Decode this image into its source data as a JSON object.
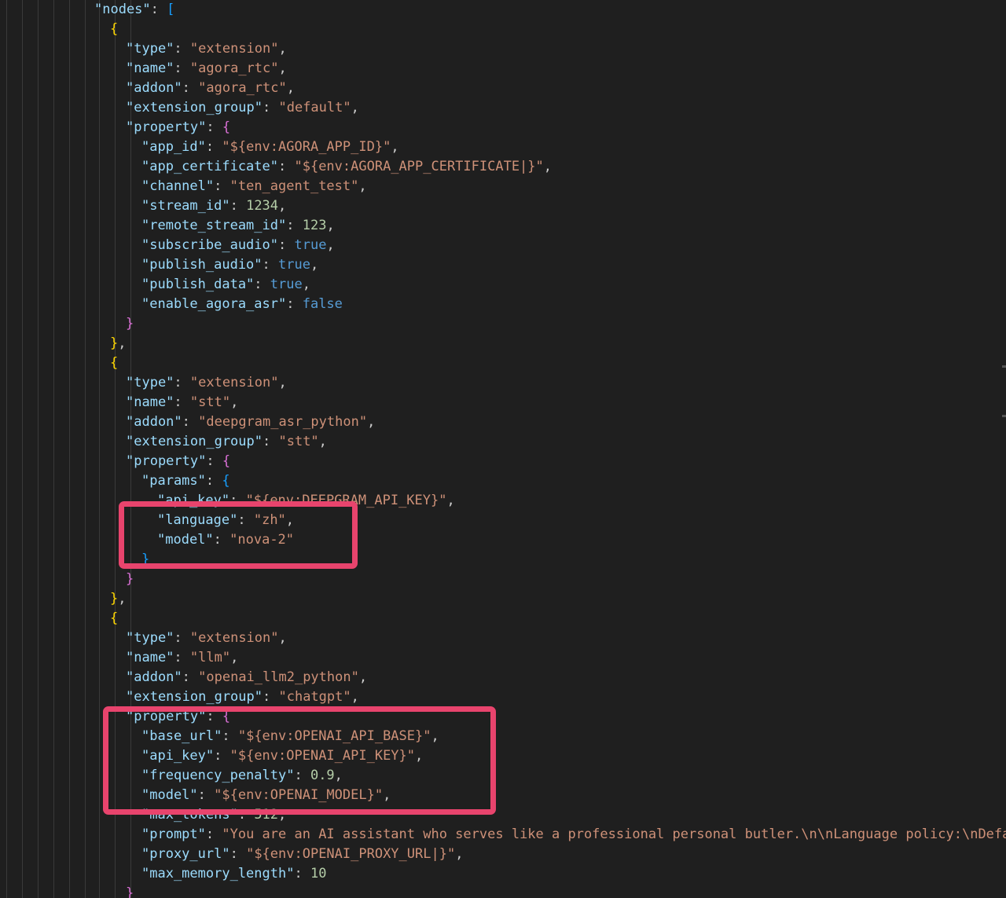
{
  "editor": {
    "lines": [
      {
        "indent": 120,
        "tokens": [
          {
            "t": "\"nodes\"",
            "c": "k"
          },
          {
            "t": ": ",
            "c": "p"
          },
          {
            "t": "[",
            "c": "br3"
          }
        ]
      },
      {
        "indent": 140,
        "tokens": [
          {
            "t": "{",
            "c": "br1"
          }
        ]
      },
      {
        "indent": 160,
        "tokens": [
          {
            "t": "\"type\"",
            "c": "k"
          },
          {
            "t": ": ",
            "c": "p"
          },
          {
            "t": "\"extension\"",
            "c": "s"
          },
          {
            "t": ",",
            "c": "p"
          }
        ]
      },
      {
        "indent": 160,
        "tokens": [
          {
            "t": "\"name\"",
            "c": "k"
          },
          {
            "t": ": ",
            "c": "p"
          },
          {
            "t": "\"agora_rtc\"",
            "c": "s"
          },
          {
            "t": ",",
            "c": "p"
          }
        ]
      },
      {
        "indent": 160,
        "tokens": [
          {
            "t": "\"addon\"",
            "c": "k"
          },
          {
            "t": ": ",
            "c": "p"
          },
          {
            "t": "\"agora_rtc\"",
            "c": "s"
          },
          {
            "t": ",",
            "c": "p"
          }
        ]
      },
      {
        "indent": 160,
        "tokens": [
          {
            "t": "\"extension_group\"",
            "c": "k"
          },
          {
            "t": ": ",
            "c": "p"
          },
          {
            "t": "\"default\"",
            "c": "s"
          },
          {
            "t": ",",
            "c": "p"
          }
        ]
      },
      {
        "indent": 160,
        "tokens": [
          {
            "t": "\"property\"",
            "c": "k"
          },
          {
            "t": ": ",
            "c": "p"
          },
          {
            "t": "{",
            "c": "br2"
          }
        ]
      },
      {
        "indent": 180,
        "tokens": [
          {
            "t": "\"app_id\"",
            "c": "k"
          },
          {
            "t": ": ",
            "c": "p"
          },
          {
            "t": "\"${env:AGORA_APP_ID}\"",
            "c": "s"
          },
          {
            "t": ",",
            "c": "p"
          }
        ]
      },
      {
        "indent": 180,
        "tokens": [
          {
            "t": "\"app_certificate\"",
            "c": "k"
          },
          {
            "t": ": ",
            "c": "p"
          },
          {
            "t": "\"${env:AGORA_APP_CERTIFICATE|}\"",
            "c": "s"
          },
          {
            "t": ",",
            "c": "p"
          }
        ]
      },
      {
        "indent": 180,
        "tokens": [
          {
            "t": "\"channel\"",
            "c": "k"
          },
          {
            "t": ": ",
            "c": "p"
          },
          {
            "t": "\"ten_agent_test\"",
            "c": "s"
          },
          {
            "t": ",",
            "c": "p"
          }
        ]
      },
      {
        "indent": 180,
        "tokens": [
          {
            "t": "\"stream_id\"",
            "c": "k"
          },
          {
            "t": ": ",
            "c": "p"
          },
          {
            "t": "1234",
            "c": "n"
          },
          {
            "t": ",",
            "c": "p"
          }
        ]
      },
      {
        "indent": 180,
        "tokens": [
          {
            "t": "\"remote_stream_id\"",
            "c": "k"
          },
          {
            "t": ": ",
            "c": "p"
          },
          {
            "t": "123",
            "c": "n"
          },
          {
            "t": ",",
            "c": "p"
          }
        ]
      },
      {
        "indent": 180,
        "tokens": [
          {
            "t": "\"subscribe_audio\"",
            "c": "k"
          },
          {
            "t": ": ",
            "c": "p"
          },
          {
            "t": "true",
            "c": "b"
          },
          {
            "t": ",",
            "c": "p"
          }
        ]
      },
      {
        "indent": 180,
        "tokens": [
          {
            "t": "\"publish_audio\"",
            "c": "k"
          },
          {
            "t": ": ",
            "c": "p"
          },
          {
            "t": "true",
            "c": "b"
          },
          {
            "t": ",",
            "c": "p"
          }
        ]
      },
      {
        "indent": 180,
        "tokens": [
          {
            "t": "\"publish_data\"",
            "c": "k"
          },
          {
            "t": ": ",
            "c": "p"
          },
          {
            "t": "true",
            "c": "b"
          },
          {
            "t": ",",
            "c": "p"
          }
        ]
      },
      {
        "indent": 180,
        "tokens": [
          {
            "t": "\"enable_agora_asr\"",
            "c": "k"
          },
          {
            "t": ": ",
            "c": "p"
          },
          {
            "t": "false",
            "c": "b"
          }
        ]
      },
      {
        "indent": 160,
        "tokens": [
          {
            "t": "}",
            "c": "br2"
          }
        ]
      },
      {
        "indent": 140,
        "tokens": [
          {
            "t": "}",
            "c": "br1"
          },
          {
            "t": ",",
            "c": "p"
          }
        ]
      },
      {
        "indent": 140,
        "tokens": [
          {
            "t": "{",
            "c": "br1"
          }
        ]
      },
      {
        "indent": 160,
        "tokens": [
          {
            "t": "\"type\"",
            "c": "k"
          },
          {
            "t": ": ",
            "c": "p"
          },
          {
            "t": "\"extension\"",
            "c": "s"
          },
          {
            "t": ",",
            "c": "p"
          }
        ]
      },
      {
        "indent": 160,
        "tokens": [
          {
            "t": "\"name\"",
            "c": "k"
          },
          {
            "t": ": ",
            "c": "p"
          },
          {
            "t": "\"stt\"",
            "c": "s"
          },
          {
            "t": ",",
            "c": "p"
          }
        ]
      },
      {
        "indent": 160,
        "tokens": [
          {
            "t": "\"addon\"",
            "c": "k"
          },
          {
            "t": ": ",
            "c": "p"
          },
          {
            "t": "\"deepgram_asr_python\"",
            "c": "s"
          },
          {
            "t": ",",
            "c": "p"
          }
        ]
      },
      {
        "indent": 160,
        "tokens": [
          {
            "t": "\"extension_group\"",
            "c": "k"
          },
          {
            "t": ": ",
            "c": "p"
          },
          {
            "t": "\"stt\"",
            "c": "s"
          },
          {
            "t": ",",
            "c": "p"
          }
        ]
      },
      {
        "indent": 160,
        "tokens": [
          {
            "t": "\"property\"",
            "c": "k"
          },
          {
            "t": ": ",
            "c": "p"
          },
          {
            "t": "{",
            "c": "br2"
          }
        ]
      },
      {
        "indent": 180,
        "tokens": [
          {
            "t": "\"params\"",
            "c": "k"
          },
          {
            "t": ": ",
            "c": "p"
          },
          {
            "t": "{",
            "c": "br3"
          }
        ]
      },
      {
        "indent": 200,
        "tokens": [
          {
            "t": "\"api_key\"",
            "c": "k"
          },
          {
            "t": ": ",
            "c": "p"
          },
          {
            "t": "\"${env:DEEPGRAM_API_KEY}\"",
            "c": "s"
          },
          {
            "t": ",",
            "c": "p"
          }
        ]
      },
      {
        "indent": 200,
        "tokens": [
          {
            "t": "\"language\"",
            "c": "k"
          },
          {
            "t": ": ",
            "c": "p"
          },
          {
            "t": "\"zh\"",
            "c": "s"
          },
          {
            "t": ",",
            "c": "p"
          }
        ]
      },
      {
        "indent": 200,
        "tokens": [
          {
            "t": "\"model\"",
            "c": "k"
          },
          {
            "t": ": ",
            "c": "p"
          },
          {
            "t": "\"nova-2\"",
            "c": "s"
          }
        ]
      },
      {
        "indent": 180,
        "tokens": [
          {
            "t": "}",
            "c": "br3"
          }
        ]
      },
      {
        "indent": 160,
        "tokens": [
          {
            "t": "}",
            "c": "br2"
          }
        ]
      },
      {
        "indent": 140,
        "tokens": [
          {
            "t": "}",
            "c": "br1"
          },
          {
            "t": ",",
            "c": "p"
          }
        ]
      },
      {
        "indent": 140,
        "tokens": [
          {
            "t": "{",
            "c": "br1"
          }
        ]
      },
      {
        "indent": 160,
        "tokens": [
          {
            "t": "\"type\"",
            "c": "k"
          },
          {
            "t": ": ",
            "c": "p"
          },
          {
            "t": "\"extension\"",
            "c": "s"
          },
          {
            "t": ",",
            "c": "p"
          }
        ]
      },
      {
        "indent": 160,
        "tokens": [
          {
            "t": "\"name\"",
            "c": "k"
          },
          {
            "t": ": ",
            "c": "p"
          },
          {
            "t": "\"llm\"",
            "c": "s"
          },
          {
            "t": ",",
            "c": "p"
          }
        ]
      },
      {
        "indent": 160,
        "tokens": [
          {
            "t": "\"addon\"",
            "c": "k"
          },
          {
            "t": ": ",
            "c": "p"
          },
          {
            "t": "\"openai_llm2_python\"",
            "c": "s"
          },
          {
            "t": ",",
            "c": "p"
          }
        ]
      },
      {
        "indent": 160,
        "tokens": [
          {
            "t": "\"extension_group\"",
            "c": "k"
          },
          {
            "t": ": ",
            "c": "p"
          },
          {
            "t": "\"chatgpt\"",
            "c": "s"
          },
          {
            "t": ",",
            "c": "p"
          }
        ]
      },
      {
        "indent": 160,
        "tokens": [
          {
            "t": "\"property\"",
            "c": "k"
          },
          {
            "t": ": ",
            "c": "p"
          },
          {
            "t": "{",
            "c": "br2"
          }
        ]
      },
      {
        "indent": 180,
        "tokens": [
          {
            "t": "\"base_url\"",
            "c": "k"
          },
          {
            "t": ": ",
            "c": "p"
          },
          {
            "t": "\"${env:OPENAI_API_BASE}\"",
            "c": "s"
          },
          {
            "t": ",",
            "c": "p"
          }
        ]
      },
      {
        "indent": 180,
        "tokens": [
          {
            "t": "\"api_key\"",
            "c": "k"
          },
          {
            "t": ": ",
            "c": "p"
          },
          {
            "t": "\"${env:OPENAI_API_KEY}\"",
            "c": "s"
          },
          {
            "t": ",",
            "c": "p"
          }
        ]
      },
      {
        "indent": 180,
        "tokens": [
          {
            "t": "\"frequency_penalty\"",
            "c": "k"
          },
          {
            "t": ": ",
            "c": "p"
          },
          {
            "t": "0.9",
            "c": "n"
          },
          {
            "t": ",",
            "c": "p"
          }
        ]
      },
      {
        "indent": 180,
        "tokens": [
          {
            "t": "\"model\"",
            "c": "k"
          },
          {
            "t": ": ",
            "c": "p"
          },
          {
            "t": "\"${env:OPENAI_MODEL}\"",
            "c": "s"
          },
          {
            "t": ",",
            "c": "p"
          }
        ]
      },
      {
        "indent": 180,
        "tokens": [
          {
            "t": "\"max_tokens\"",
            "c": "k"
          },
          {
            "t": ": ",
            "c": "p"
          },
          {
            "t": "512",
            "c": "n"
          },
          {
            "t": ",",
            "c": "p"
          }
        ]
      },
      {
        "indent": 180,
        "tokens": [
          {
            "t": "\"prompt\"",
            "c": "k"
          },
          {
            "t": ": ",
            "c": "p"
          },
          {
            "t": "\"You are an AI assistant who serves like a professional personal butler.\\n\\nLanguage policy:\\nDefau",
            "c": "s"
          }
        ]
      },
      {
        "indent": 180,
        "tokens": [
          {
            "t": "\"proxy_url\"",
            "c": "k"
          },
          {
            "t": ": ",
            "c": "p"
          },
          {
            "t": "\"${env:OPENAI_PROXY_URL|}\"",
            "c": "s"
          },
          {
            "t": ",",
            "c": "p"
          }
        ]
      },
      {
        "indent": 180,
        "tokens": [
          {
            "t": "\"max_memory_length\"",
            "c": "k"
          },
          {
            "t": ": ",
            "c": "p"
          },
          {
            "t": "10",
            "c": "n"
          }
        ]
      },
      {
        "indent": 160,
        "tokens": [
          {
            "t": "}",
            "c": "br2"
          }
        ]
      }
    ]
  }
}
